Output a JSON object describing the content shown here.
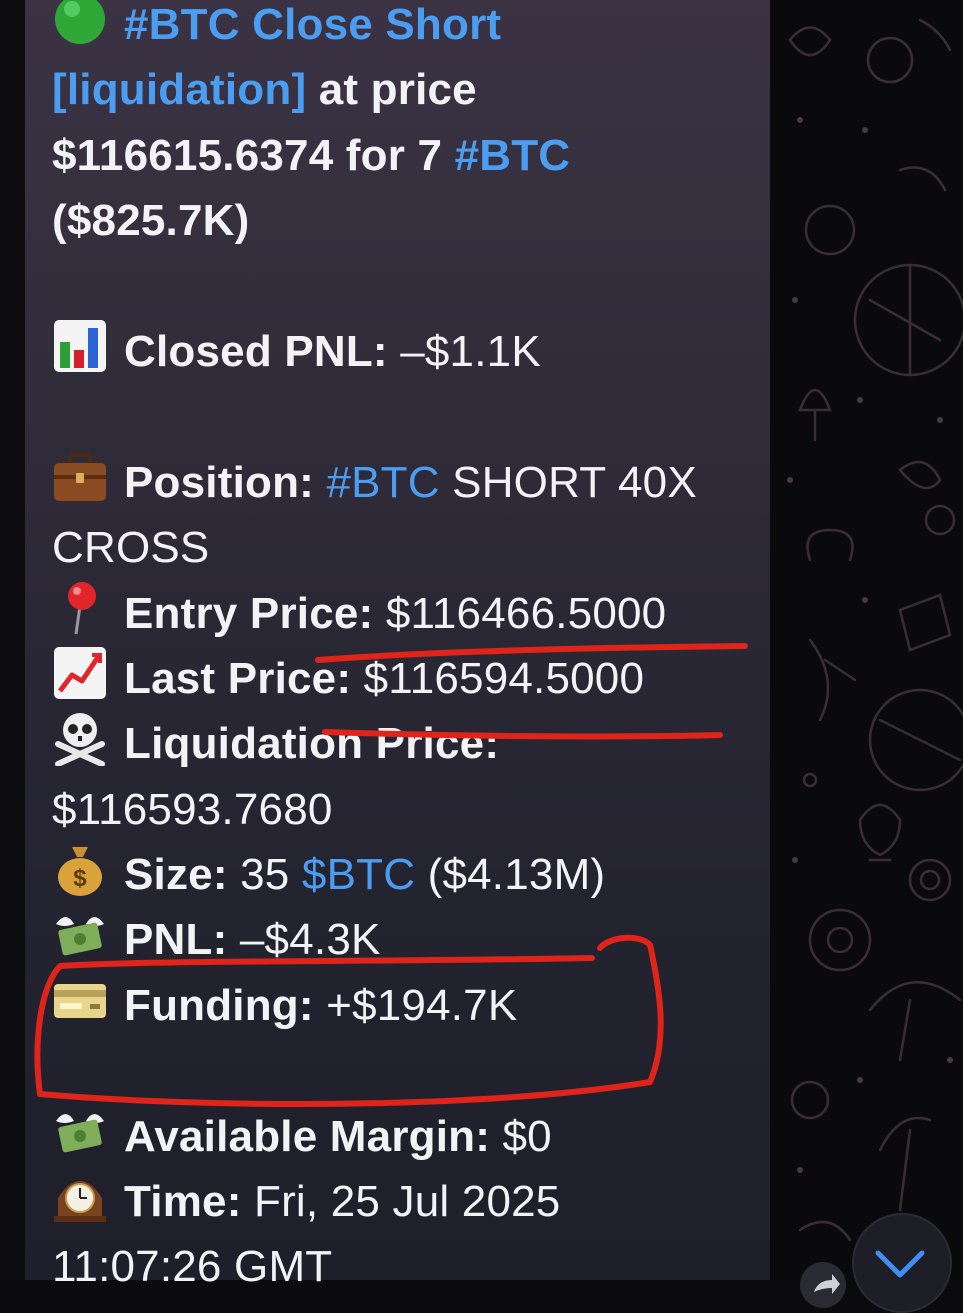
{
  "message": {
    "header": {
      "status_emoji": "green-circle-icon",
      "title": "#BTC Close Short",
      "type_tag": "[liquidation]",
      "text_at_price": " at price",
      "price_line": "$116615.6374 for 7 ",
      "price_tag": "#BTC",
      "notional": "($825.7K)"
    },
    "closed_pnl": {
      "icon": "bar-chart-icon",
      "label": "Closed PNL:",
      "value": " –$1.1K"
    },
    "position": {
      "icon": "briefcase-icon",
      "label": "Position:",
      "tag": " #BTC",
      "value": " SHORT 40X",
      "value_cont": "CROSS"
    },
    "entry_price": {
      "icon": "round-pushpin-icon",
      "label": "Entry Price:",
      "value": " $116466.5000"
    },
    "last_price": {
      "icon": "chart-increasing-icon",
      "label": "Last Price:",
      "value": " $116594.5000"
    },
    "liquidation_price": {
      "icon": "skull-crossbones-icon",
      "label": "Liquidation Price:",
      "value": "$116593.7680"
    },
    "size": {
      "icon": "money-bag-icon",
      "label": "Size:",
      "value_pre": " 35 ",
      "tag": "$BTC",
      "value_post": " ($4.13M)"
    },
    "pnl": {
      "icon": "money-with-wings-icon",
      "label": "PNL:",
      "value": " –$4.3K"
    },
    "funding": {
      "icon": "credit-card-icon",
      "label": "Funding:",
      "value": " +$194.7K"
    },
    "available_margin": {
      "icon": "money-with-wings-icon",
      "label": "Available Margin:",
      "value": " $0"
    },
    "time": {
      "icon": "mantelpiece-clock-icon",
      "label": "Time:",
      "value": " Fri, 25 Jul 2025",
      "value_cont": "11:07:26 GMT"
    }
  },
  "annotations": {
    "color": "#e0241a"
  },
  "colors": {
    "accent": "#4a9df0",
    "text": "#f3f3f6"
  },
  "ui": {
    "scroll_down_icon": "chevron-down-icon",
    "share_icon": "share-icon"
  }
}
